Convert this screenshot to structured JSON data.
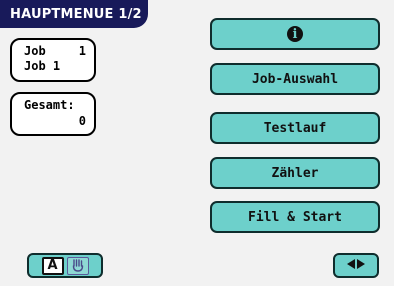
{
  "header": {
    "title": "HAUPTMENUE 1/2"
  },
  "job_panel": {
    "row1_label": "Job",
    "row1_value": "1",
    "row2_label": "Job 1"
  },
  "total_panel": {
    "label": "Gesamt:",
    "value": "0"
  },
  "menu": {
    "info_icon": "info-icon",
    "job_select": "Job-Auswahl",
    "test_run": "Testlauf",
    "counter": "Zähler",
    "fill_start": "Fill & Start"
  },
  "footer": {
    "mode_a_label": "A",
    "mode_b_icon": "hand-icon",
    "nav_icon": "left-right-arrows-icon"
  },
  "colors": {
    "title_bg": "#181a5a",
    "button_bg": "#6dd0cb",
    "panel_bg": "#ffffff"
  }
}
